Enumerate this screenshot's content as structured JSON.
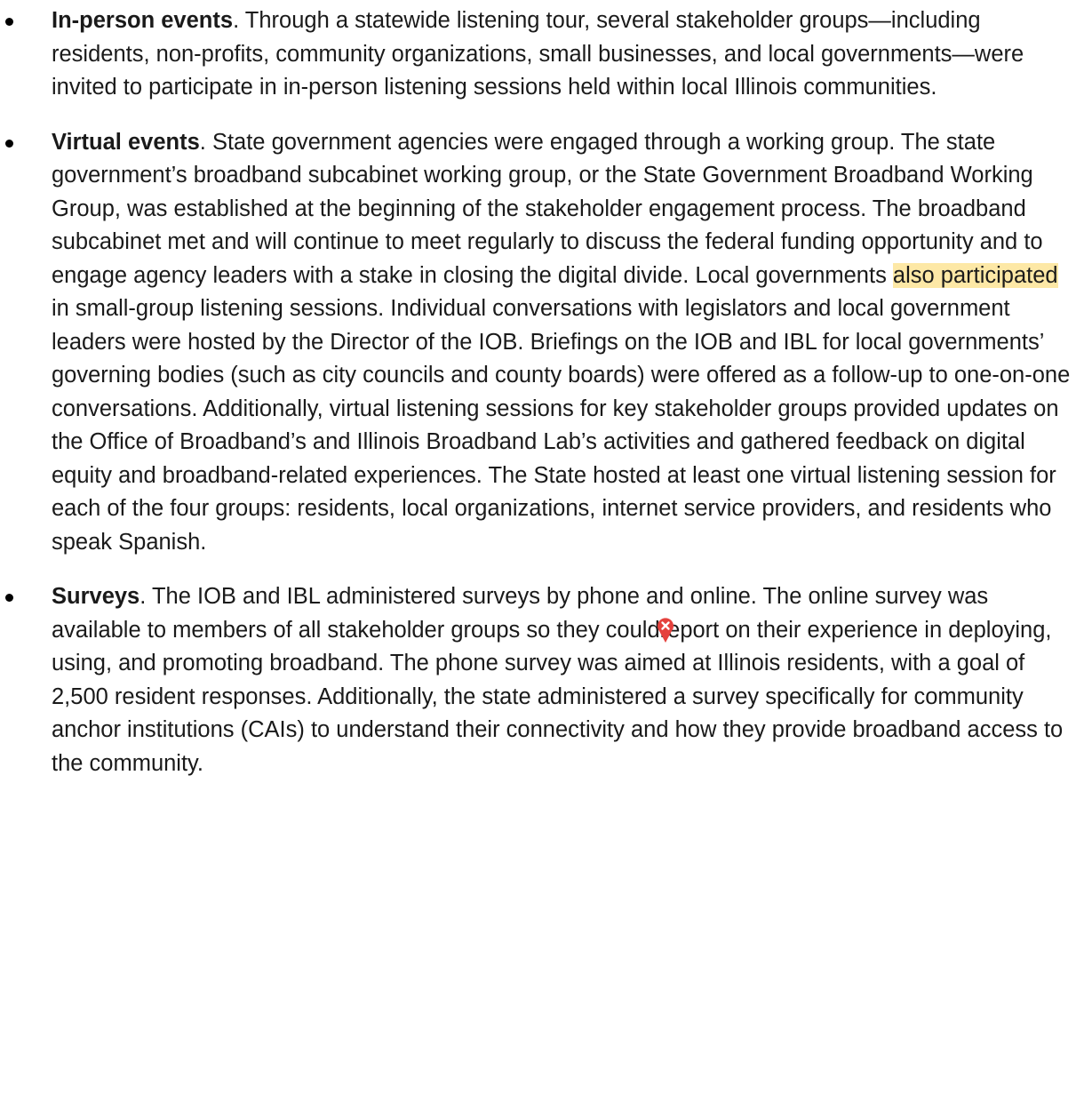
{
  "items": [
    {
      "lead": "In-person events",
      "text": ". Through a statewide listening tour, several stakeholder groups—including residents, non-profits, community organizations, small businesses, and local governments—were invited to participate in in-person listening sessions held within local Illinois communities."
    },
    {
      "lead": "Virtual events",
      "text_before": ". State government agencies were engaged through a working group. The state government’s broadband subcabinet working group, or the State Government Broadband Working Group, was established at the beginning of the stakeholder engagement process. The broadband subcabinet met and will continue to meet regularly to discuss the federal funding opportunity and to engage agency leaders with a stake in closing the digital divide. Local governments ",
      "highlight": "also participated ",
      "text_after": "in small-group listening sessions. Individual conversations with legislators and local government leaders were hosted by the Director of the IOB. Briefings on the IOB and IBL for local governments’ governing bodies (such as city councils and county boards) were offered as a follow-up to one-on-one conversations. Additionally, virtual listening sessions for key stakeholder groups provided updates on the Office of Broadband’s and Illinois Broadband Lab’s activities and gathered feedback on digital equity and broadband-related experiences. The State hosted at least one virtual listening session for each of the four groups: residents, local organizations, internet service providers, and residents who speak Spanish."
    },
    {
      "lead": "Surveys",
      "text_before": ". The IOB and IBL administered surveys by phone and online. The online survey was available to members of all stakeholder groups so they could",
      "text_after": "report on their experience in deploying, using, and promoting broadband. The phone survey was aimed at Illinois residents, with a goal of 2,500 resident responses. Additionally, the state administered a survey specifically for community anchor institutions (CAIs) to understand their connectivity and how they provide broadband access to the community."
    }
  ],
  "colors": {
    "highlight": "#fde8a6",
    "comment_marker": "#e5413d"
  },
  "icons": {
    "comment_marker": "comment-pin-icon"
  }
}
